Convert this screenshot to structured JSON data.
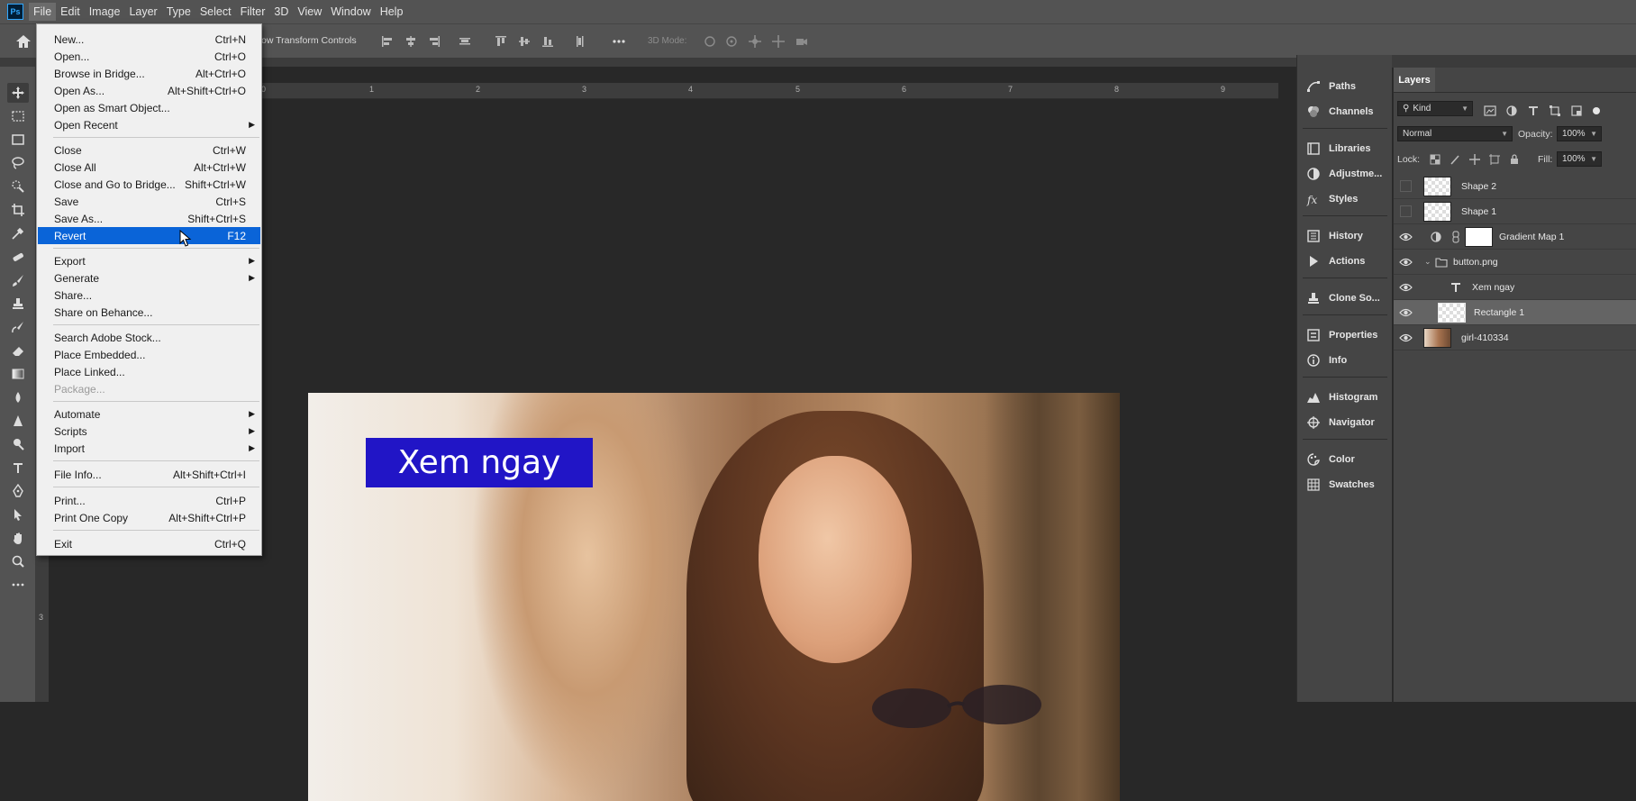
{
  "menubar": {
    "logo": "Ps",
    "items": [
      "File",
      "Edit",
      "Image",
      "Layer",
      "Type",
      "Select",
      "Filter",
      "3D",
      "View",
      "Window",
      "Help"
    ]
  },
  "options": {
    "transform_label": "ow Transform Controls",
    "mode3d_label": "3D Mode:"
  },
  "ruler": {
    "top_numbers": [
      "0",
      "1",
      "2",
      "3",
      "4",
      "5",
      "6",
      "7",
      "8",
      "9"
    ],
    "left_number": "3"
  },
  "file_menu": {
    "items": [
      {
        "label": "New...",
        "shortcut": "Ctrl+N"
      },
      {
        "label": "Open...",
        "shortcut": "Ctrl+O"
      },
      {
        "label": "Browse in Bridge...",
        "shortcut": "Alt+Ctrl+O"
      },
      {
        "label": "Open As...",
        "shortcut": "Alt+Shift+Ctrl+O"
      },
      {
        "label": "Open as Smart Object...",
        "shortcut": ""
      },
      {
        "label": "Open Recent",
        "shortcut": "",
        "submenu": true
      },
      {
        "label": "Close",
        "shortcut": "Ctrl+W"
      },
      {
        "label": "Close All",
        "shortcut": "Alt+Ctrl+W"
      },
      {
        "label": "Close and Go to Bridge...",
        "shortcut": "Shift+Ctrl+W"
      },
      {
        "label": "Save",
        "shortcut": "Ctrl+S"
      },
      {
        "label": "Save As...",
        "shortcut": "Shift+Ctrl+S"
      },
      {
        "label": "Revert",
        "shortcut": "F12",
        "selected": true
      },
      {
        "label": "Export",
        "shortcut": "",
        "submenu": true
      },
      {
        "label": "Generate",
        "shortcut": "",
        "submenu": true
      },
      {
        "label": "Share...",
        "shortcut": ""
      },
      {
        "label": "Share on Behance...",
        "shortcut": ""
      },
      {
        "label": "Search Adobe Stock...",
        "shortcut": ""
      },
      {
        "label": "Place Embedded...",
        "shortcut": ""
      },
      {
        "label": "Place Linked...",
        "shortcut": ""
      },
      {
        "label": "Package...",
        "shortcut": "",
        "disabled": true
      },
      {
        "label": "Automate",
        "shortcut": "",
        "submenu": true
      },
      {
        "label": "Scripts",
        "shortcut": "",
        "submenu": true
      },
      {
        "label": "Import",
        "shortcut": "",
        "submenu": true
      },
      {
        "label": "File Info...",
        "shortcut": "Alt+Shift+Ctrl+I"
      },
      {
        "label": "Print...",
        "shortcut": "Ctrl+P"
      },
      {
        "label": "Print One Copy",
        "shortcut": "Alt+Shift+Ctrl+P"
      },
      {
        "label": "Exit",
        "shortcut": "Ctrl+Q"
      }
    ]
  },
  "canvas": {
    "button_text": "Xem ngay",
    "button_color": "#2115c6"
  },
  "side_panels": {
    "items": [
      "Paths",
      "Channels",
      "Libraries",
      "Adjustme...",
      "Styles",
      "History",
      "Actions",
      "Clone So...",
      "Properties",
      "Info",
      "Histogram",
      "Navigator",
      "Color",
      "Swatches"
    ]
  },
  "layers": {
    "tab": "Layers",
    "filter_kind": "Kind",
    "blend_mode": "Normal",
    "opacity_label": "Opacity:",
    "opacity_value": "100%",
    "lock_label": "Lock:",
    "fill_label": "Fill:",
    "fill_value": "100%",
    "rows": [
      {
        "name": "Shape 2",
        "visible": false
      },
      {
        "name": "Shape 1",
        "visible": false
      },
      {
        "name": "Gradient Map 1",
        "visible": true
      },
      {
        "name": "button.png",
        "visible": true
      },
      {
        "name": "Xem ngay",
        "visible": true
      },
      {
        "name": "Rectangle 1",
        "visible": true,
        "selected": true
      },
      {
        "name": "girl-410334",
        "visible": true
      }
    ]
  }
}
